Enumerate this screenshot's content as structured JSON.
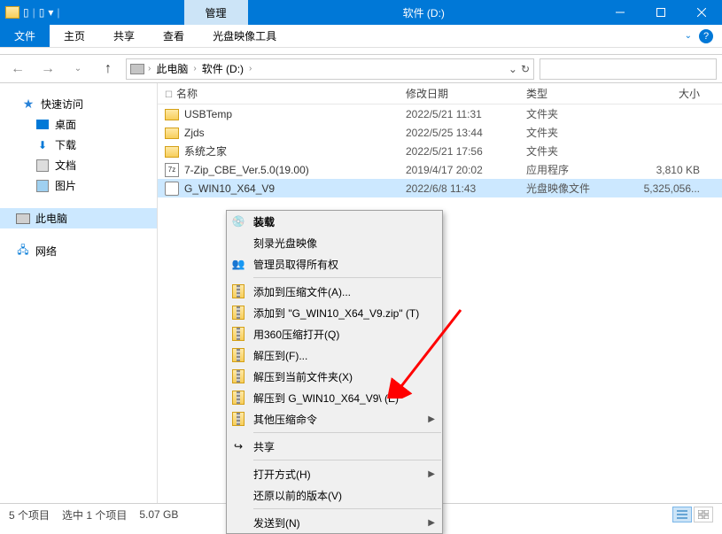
{
  "title": "软件 (D:)",
  "contextTab": "管理",
  "ribbonTabs": {
    "file": "文件",
    "home": "主页",
    "share": "共享",
    "view": "查看",
    "tool": "光盘映像工具"
  },
  "breadcrumb": {
    "pc": "此电脑",
    "drive": "软件 (D:)"
  },
  "searchPlaceholder": "",
  "sidebar": {
    "quick": "快速访问",
    "desktop": "桌面",
    "downloads": "下载",
    "documents": "文档",
    "pictures": "图片",
    "thispc": "此电脑",
    "network": "网络"
  },
  "columns": {
    "name": "名称",
    "date": "修改日期",
    "type": "类型",
    "size": "大小"
  },
  "files": [
    {
      "name": "USBTemp",
      "date": "2022/5/21 11:31",
      "type": "文件夹",
      "size": "",
      "kind": "folder"
    },
    {
      "name": "Zjds",
      "date": "2022/5/25 13:44",
      "type": "文件夹",
      "size": "",
      "kind": "folder"
    },
    {
      "name": "系统之家",
      "date": "2022/5/21 17:56",
      "type": "文件夹",
      "size": "",
      "kind": "folder"
    },
    {
      "name": "7-Zip_CBE_Ver.5.0(19.00)",
      "date": "2019/4/17 20:02",
      "type": "应用程序",
      "size": "3,810 KB",
      "kind": "app"
    },
    {
      "name": "G_WIN10_X64_V9",
      "date": "2022/6/8 11:43",
      "type": "光盘映像文件",
      "size": "5,325,056...",
      "kind": "iso"
    }
  ],
  "contextMenu": {
    "mount": "装载",
    "burn": "刻录光盘映像",
    "admin": "管理员取得所有权",
    "addArchive": "添加到压缩文件(A)...",
    "addZip": "添加到 \"G_WIN10_X64_V9.zip\" (T)",
    "open360": "用360压缩打开(Q)",
    "extractTo": "解压到(F)...",
    "extractHere": "解压到当前文件夹(X)",
    "extractNamed": "解压到 G_WIN10_X64_V9\\ (E)",
    "otherZip": "其他压缩命令",
    "share": "共享",
    "openWith": "打开方式(H)",
    "restore": "还原以前的版本(V)",
    "sendTo": "发送到(N)"
  },
  "status": {
    "items": "5 个项目",
    "selected": "选中 1 个项目",
    "size": "5.07 GB"
  }
}
